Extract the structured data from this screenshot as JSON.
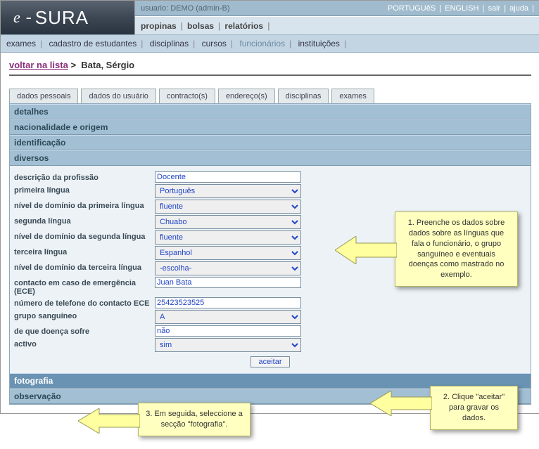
{
  "header": {
    "user_label": "usuario:",
    "user_value": "DEMO (admin-B)",
    "links": [
      "PORTUGUêS",
      "ENGLISH",
      "sair",
      "ajuda"
    ],
    "logo_e": "e",
    "logo_dash": "-",
    "logo_sura": "SURA"
  },
  "menu1": [
    "propinas",
    "bolsas",
    "relatórios"
  ],
  "menu2": [
    "exames",
    "cadastro de estudantes",
    "disciplinas",
    "cursos",
    "funcionários",
    "instituições"
  ],
  "menu2_active_index": 4,
  "breadcrumb": {
    "back": "voltar na lista",
    "sep": ">",
    "current": "Bata, Sérgio"
  },
  "tabs": [
    "dados pessoais",
    "dados do usuário",
    "contracto(s)",
    "endereço(s)",
    "disciplinas",
    "exames"
  ],
  "sections": {
    "detalhes": "detalhes",
    "nacionalidade": "nacionalidade e origem",
    "identificacao": "identificação",
    "diversos": "diversos",
    "fotografia": "fotografia",
    "observacao": "observação"
  },
  "diversos": {
    "descricao_profissao": {
      "label": "descrição da profissão",
      "value": "Docente"
    },
    "primeira_lingua": {
      "label": "primeira língua",
      "value": "Português"
    },
    "nivel_primeira": {
      "label": "nível de domínio da primeira língua",
      "value": "fluente"
    },
    "segunda_lingua": {
      "label": "segunda língua",
      "value": "Chuabo"
    },
    "nivel_segunda": {
      "label": "nível de domínio da segunda língua",
      "value": "fluente"
    },
    "terceira_lingua": {
      "label": "terceira língua",
      "value": "Espanhol"
    },
    "nivel_terceira": {
      "label": "nível de domínio da terceira língua",
      "value": "-escolha-"
    },
    "contacto_ece": {
      "label": "contacto em caso de emergência (ECE)",
      "value": "Juan Bata"
    },
    "tel_ece": {
      "label": "número de telefone do contacto ECE",
      "value": "25423523525"
    },
    "grupo_sang": {
      "label": "grupo sanguíneo",
      "value": "A"
    },
    "doenca": {
      "label": "de que doença sofre",
      "value": "não"
    },
    "activo": {
      "label": "activo",
      "value": "sim"
    },
    "aceitar": "aceitar"
  },
  "callouts": {
    "c1": "1. Preenche os dados sobre dados sobre as línguas que fala o funcionário, o grupo sanguíneo e eventuais doenças como mastrado no exemplo.",
    "c2": "2. Clique \"aceitar\" para gravar os dados.",
    "c3": "3. Em seguida, seleccione a secção \"fotografia\"."
  }
}
